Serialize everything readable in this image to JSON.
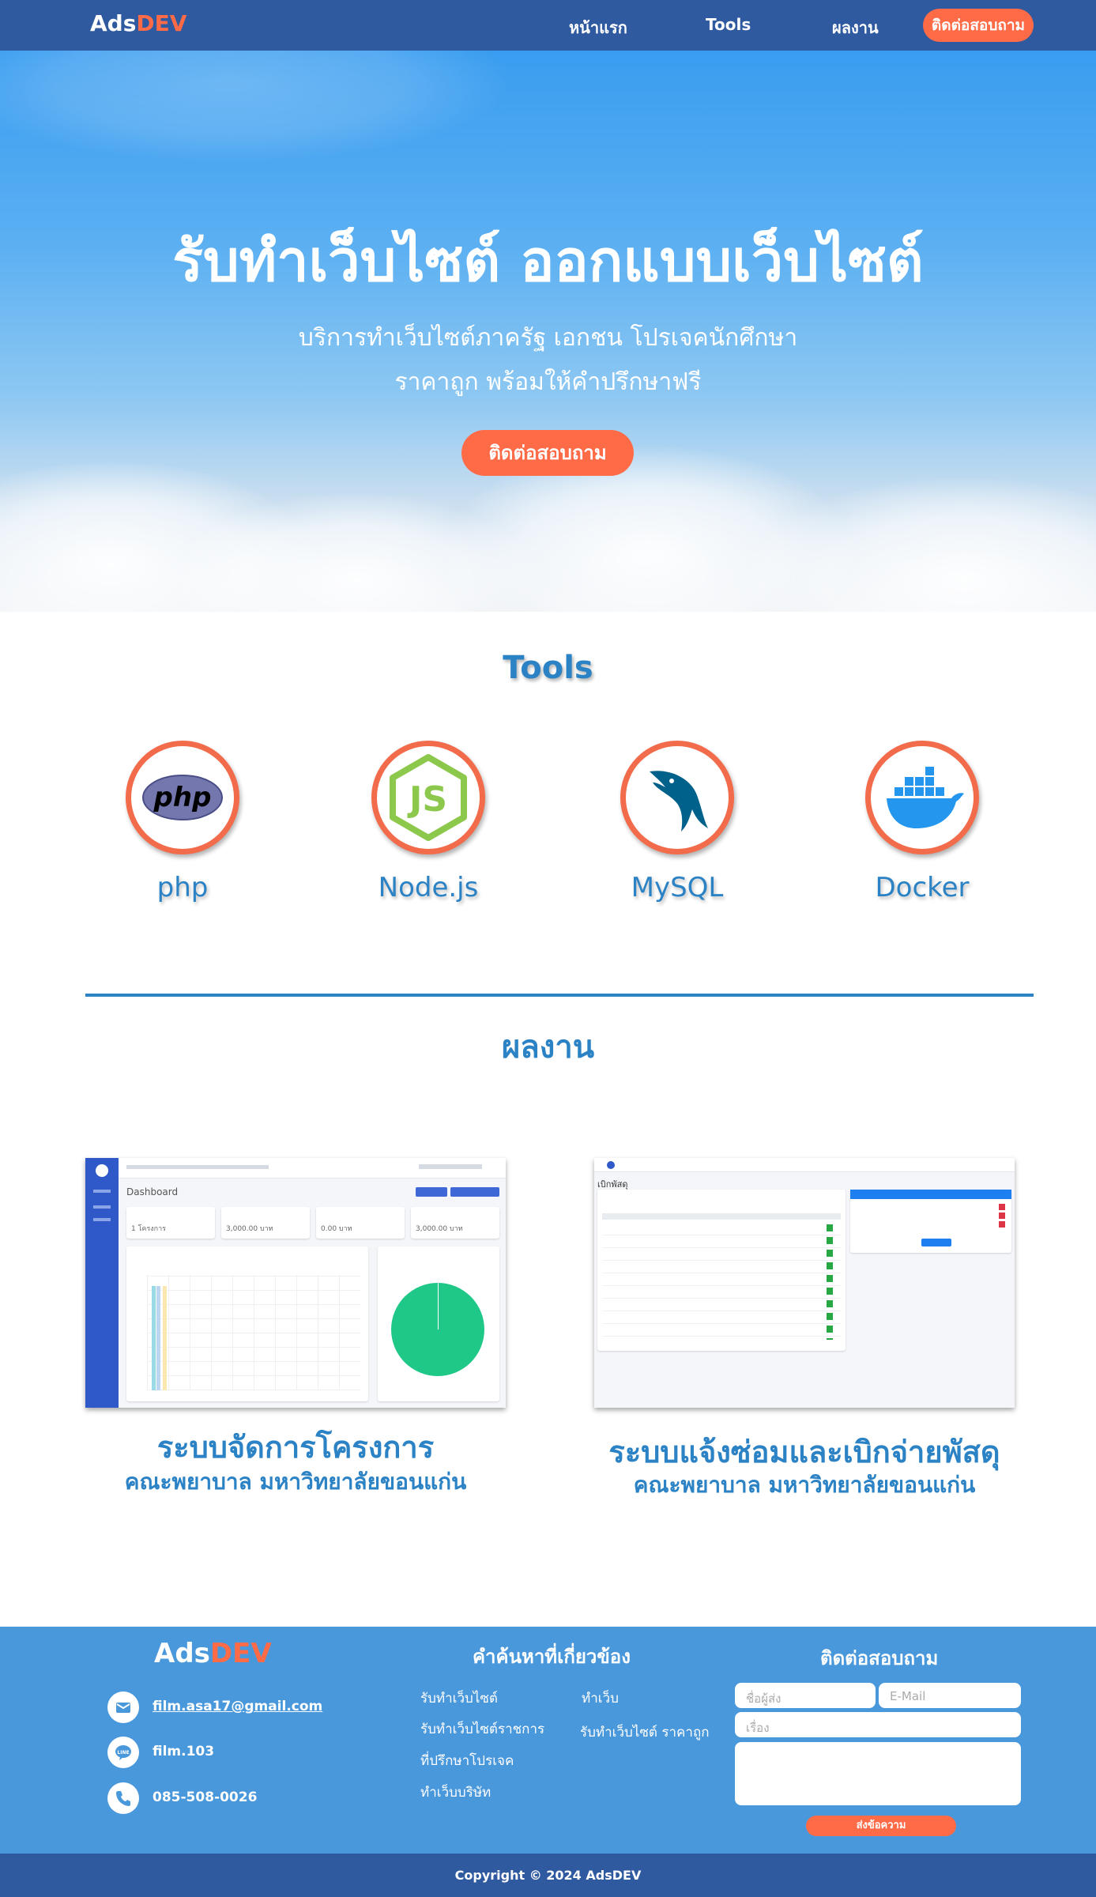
{
  "brand": {
    "prefix": "Ads",
    "accent": "DEV"
  },
  "colors": {
    "nav": "#2f5aa0",
    "accent": "#ff6b47",
    "primary": "#2b82c4",
    "footer": "#4a98dc"
  },
  "nav": {
    "links": [
      "หน้าแรก",
      "Tools",
      "ผลงาน"
    ],
    "cta": "ติดต่อสอบถาม"
  },
  "hero": {
    "title": "รับทำเว็บไซต์ ออกแบบเว็บไซต์",
    "subtitle_1": "บริการทำเว็บไซต์ภาครัฐ เอกชน โปรเจคนักศึกษา",
    "subtitle_2": "ราคาถูก พร้อมให้คำปรึกษาฟรี",
    "cta": "ติดต่อสอบถาม"
  },
  "tools": {
    "title": "Tools",
    "items": [
      {
        "label": "php",
        "icon": "php-icon"
      },
      {
        "label": "Node.js",
        "icon": "nodejs-icon"
      },
      {
        "label": "MySQL",
        "icon": "mysql-icon"
      },
      {
        "label": "Docker",
        "icon": "docker-icon"
      }
    ]
  },
  "works": {
    "title": "ผลงาน",
    "items": [
      {
        "title": "ระบบจัดการโครงการ",
        "subtitle": "คณะพยาบาล มหาวิทยาลัยขอนแก่น",
        "screenshot": {
          "header": "Dashboard",
          "cards": [
            "1 โครงการ",
            "3,000.00 บาท",
            "0.00 บาท",
            "3,000.00 บาท"
          ]
        }
      },
      {
        "title": "ระบบแจ้งซ่อมและเบิกจ่ายพัสดุ",
        "subtitle": "คณะพยาบาล มหาวิทยาลัยขอนแก่น",
        "screenshot": {
          "header": "เบิกพัสดุ"
        }
      }
    ]
  },
  "footer": {
    "contact": {
      "email": "film.asa17@gmail.com",
      "line": "film.103",
      "phone": "085-508-0026"
    },
    "keywords_title": "คำค้นหาที่เกี่ยวข้อง",
    "keywords_col1": [
      "รับทำเว็บไซต์",
      "รับทำเว็บไซต์ราชการ",
      "ที่ปรึกษาโปรเจค",
      "ทำเว็บบริษัท"
    ],
    "keywords_col2": [
      "ทำเว็บ",
      "รับทำเว็บไซต์ ราคาถูก"
    ],
    "form_title": "ติดต่อสอบถาม",
    "form": {
      "name_placeholder": "ชื่อผู้ส่ง",
      "email_placeholder": "E-Mail",
      "subject_placeholder": "เรื่อง",
      "send": "ส่งข้อความ"
    },
    "copyright": "Copyright © 2024 AdsDEV"
  }
}
